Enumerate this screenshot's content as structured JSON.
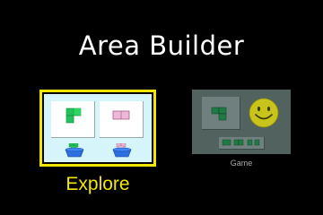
{
  "title": "Area Builder",
  "screens": [
    {
      "label": "Explore",
      "selected": true
    },
    {
      "label": "Game",
      "selected": false
    }
  ],
  "colors": {
    "background": "#000000",
    "title": "#ffffff",
    "selection_border": "#f2e700",
    "explore_bg": "#d6f5fa",
    "green_shape": "#22c25a",
    "pink_shape": "#f0b8d8",
    "game_bg_dimmed": "#51625f",
    "game_label": "#a8a8a8",
    "smiley": "#c8c41a"
  },
  "icons": {
    "explore_left_shape": "green-l-shape-icon",
    "explore_right_shape": "pink-rectangle-icon",
    "bucket_left": "green-shape-bucket-icon",
    "bucket_right": "pink-shape-bucket-icon",
    "game_shape": "green-shape-icon",
    "game_face": "smiley-face-icon",
    "game_strip": "shape-strip-icon"
  }
}
